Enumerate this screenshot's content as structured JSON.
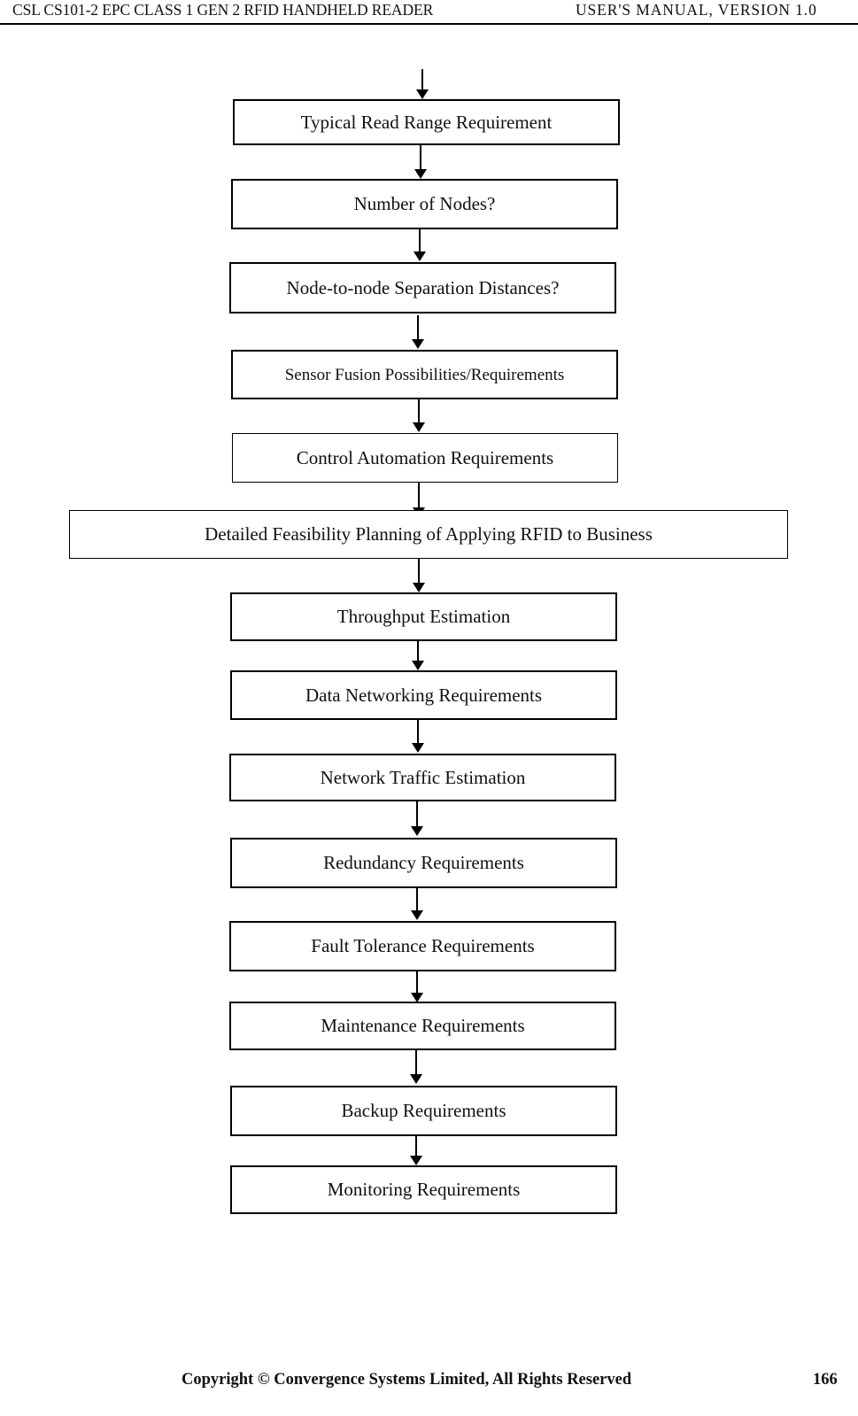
{
  "header": {
    "left_title": "CSL CS101-2 EPC CLASS 1 GEN 2 RFID HANDHELD READER",
    "right_title": "USER'S  MANUAL,  VERSION  1.0"
  },
  "footer": {
    "copyright": "Copyright © Convergence Systems Limited, All Rights Reserved",
    "page_number": "166"
  },
  "flowchart": {
    "nodes": [
      {
        "label": "Typical Read Range Requirement"
      },
      {
        "label": "Number of Nodes?"
      },
      {
        "label": "Node-to-node Separation Distances?"
      },
      {
        "label": "Sensor Fusion Possibilities/Requirements"
      },
      {
        "label": "Control Automation Requirements"
      },
      {
        "label": "Detailed Feasibility Planning of Applying RFID to Business"
      },
      {
        "label": "Throughput Estimation"
      },
      {
        "label": "Data Networking Requirements"
      },
      {
        "label": "Network Traffic Estimation"
      },
      {
        "label": "Redundancy Requirements"
      },
      {
        "label": "Fault Tolerance Requirements"
      },
      {
        "label": "Maintenance Requirements"
      },
      {
        "label": "Backup Requirements"
      },
      {
        "label": "Monitoring Requirements"
      }
    ],
    "connector_count": 14,
    "connector_direction": "down"
  }
}
